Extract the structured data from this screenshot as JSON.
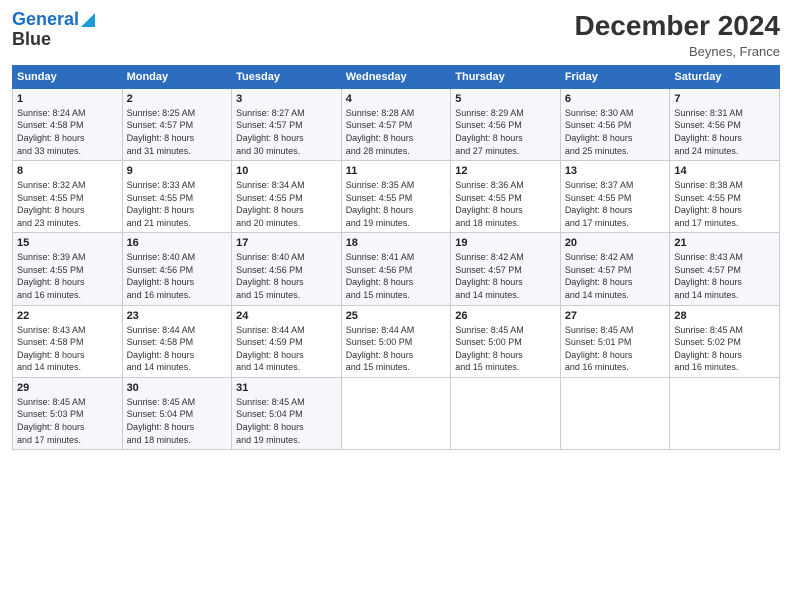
{
  "logo": {
    "line1": "General",
    "line2": "Blue"
  },
  "title": "December 2024",
  "subtitle": "Beynes, France",
  "days_header": [
    "Sunday",
    "Monday",
    "Tuesday",
    "Wednesday",
    "Thursday",
    "Friday",
    "Saturday"
  ],
  "weeks": [
    [
      {
        "day": "1",
        "info": "Sunrise: 8:24 AM\nSunset: 4:58 PM\nDaylight: 8 hours\nand 33 minutes."
      },
      {
        "day": "2",
        "info": "Sunrise: 8:25 AM\nSunset: 4:57 PM\nDaylight: 8 hours\nand 31 minutes."
      },
      {
        "day": "3",
        "info": "Sunrise: 8:27 AM\nSunset: 4:57 PM\nDaylight: 8 hours\nand 30 minutes."
      },
      {
        "day": "4",
        "info": "Sunrise: 8:28 AM\nSunset: 4:57 PM\nDaylight: 8 hours\nand 28 minutes."
      },
      {
        "day": "5",
        "info": "Sunrise: 8:29 AM\nSunset: 4:56 PM\nDaylight: 8 hours\nand 27 minutes."
      },
      {
        "day": "6",
        "info": "Sunrise: 8:30 AM\nSunset: 4:56 PM\nDaylight: 8 hours\nand 25 minutes."
      },
      {
        "day": "7",
        "info": "Sunrise: 8:31 AM\nSunset: 4:56 PM\nDaylight: 8 hours\nand 24 minutes."
      }
    ],
    [
      {
        "day": "8",
        "info": "Sunrise: 8:32 AM\nSunset: 4:55 PM\nDaylight: 8 hours\nand 23 minutes."
      },
      {
        "day": "9",
        "info": "Sunrise: 8:33 AM\nSunset: 4:55 PM\nDaylight: 8 hours\nand 21 minutes."
      },
      {
        "day": "10",
        "info": "Sunrise: 8:34 AM\nSunset: 4:55 PM\nDaylight: 8 hours\nand 20 minutes."
      },
      {
        "day": "11",
        "info": "Sunrise: 8:35 AM\nSunset: 4:55 PM\nDaylight: 8 hours\nand 19 minutes."
      },
      {
        "day": "12",
        "info": "Sunrise: 8:36 AM\nSunset: 4:55 PM\nDaylight: 8 hours\nand 18 minutes."
      },
      {
        "day": "13",
        "info": "Sunrise: 8:37 AM\nSunset: 4:55 PM\nDaylight: 8 hours\nand 17 minutes."
      },
      {
        "day": "14",
        "info": "Sunrise: 8:38 AM\nSunset: 4:55 PM\nDaylight: 8 hours\nand 17 minutes."
      }
    ],
    [
      {
        "day": "15",
        "info": "Sunrise: 8:39 AM\nSunset: 4:55 PM\nDaylight: 8 hours\nand 16 minutes."
      },
      {
        "day": "16",
        "info": "Sunrise: 8:40 AM\nSunset: 4:56 PM\nDaylight: 8 hours\nand 16 minutes."
      },
      {
        "day": "17",
        "info": "Sunrise: 8:40 AM\nSunset: 4:56 PM\nDaylight: 8 hours\nand 15 minutes."
      },
      {
        "day": "18",
        "info": "Sunrise: 8:41 AM\nSunset: 4:56 PM\nDaylight: 8 hours\nand 15 minutes."
      },
      {
        "day": "19",
        "info": "Sunrise: 8:42 AM\nSunset: 4:57 PM\nDaylight: 8 hours\nand 14 minutes."
      },
      {
        "day": "20",
        "info": "Sunrise: 8:42 AM\nSunset: 4:57 PM\nDaylight: 8 hours\nand 14 minutes."
      },
      {
        "day": "21",
        "info": "Sunrise: 8:43 AM\nSunset: 4:57 PM\nDaylight: 8 hours\nand 14 minutes."
      }
    ],
    [
      {
        "day": "22",
        "info": "Sunrise: 8:43 AM\nSunset: 4:58 PM\nDaylight: 8 hours\nand 14 minutes."
      },
      {
        "day": "23",
        "info": "Sunrise: 8:44 AM\nSunset: 4:58 PM\nDaylight: 8 hours\nand 14 minutes."
      },
      {
        "day": "24",
        "info": "Sunrise: 8:44 AM\nSunset: 4:59 PM\nDaylight: 8 hours\nand 14 minutes."
      },
      {
        "day": "25",
        "info": "Sunrise: 8:44 AM\nSunset: 5:00 PM\nDaylight: 8 hours\nand 15 minutes."
      },
      {
        "day": "26",
        "info": "Sunrise: 8:45 AM\nSunset: 5:00 PM\nDaylight: 8 hours\nand 15 minutes."
      },
      {
        "day": "27",
        "info": "Sunrise: 8:45 AM\nSunset: 5:01 PM\nDaylight: 8 hours\nand 16 minutes."
      },
      {
        "day": "28",
        "info": "Sunrise: 8:45 AM\nSunset: 5:02 PM\nDaylight: 8 hours\nand 16 minutes."
      }
    ],
    [
      {
        "day": "29",
        "info": "Sunrise: 8:45 AM\nSunset: 5:03 PM\nDaylight: 8 hours\nand 17 minutes."
      },
      {
        "day": "30",
        "info": "Sunrise: 8:45 AM\nSunset: 5:04 PM\nDaylight: 8 hours\nand 18 minutes."
      },
      {
        "day": "31",
        "info": "Sunrise: 8:45 AM\nSunset: 5:04 PM\nDaylight: 8 hours\nand 19 minutes."
      },
      {
        "day": "",
        "info": ""
      },
      {
        "day": "",
        "info": ""
      },
      {
        "day": "",
        "info": ""
      },
      {
        "day": "",
        "info": ""
      }
    ]
  ]
}
